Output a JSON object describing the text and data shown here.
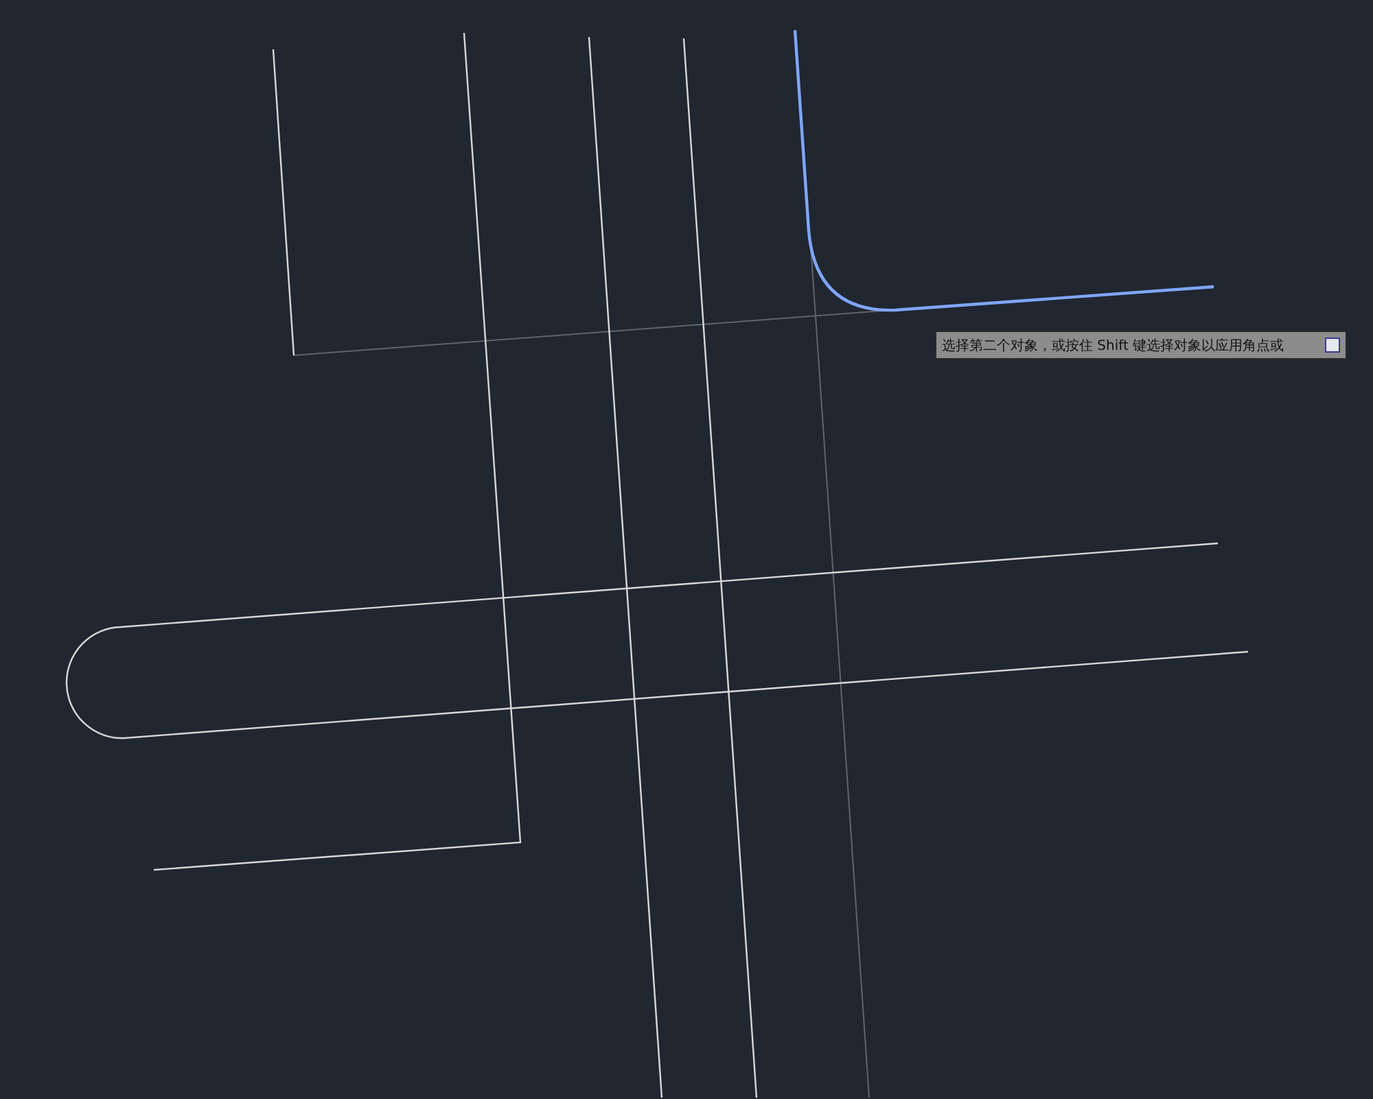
{
  "tooltip": {
    "text": "选择第二个对象，或按住 Shift 键选择对象以应用角点或"
  }
}
